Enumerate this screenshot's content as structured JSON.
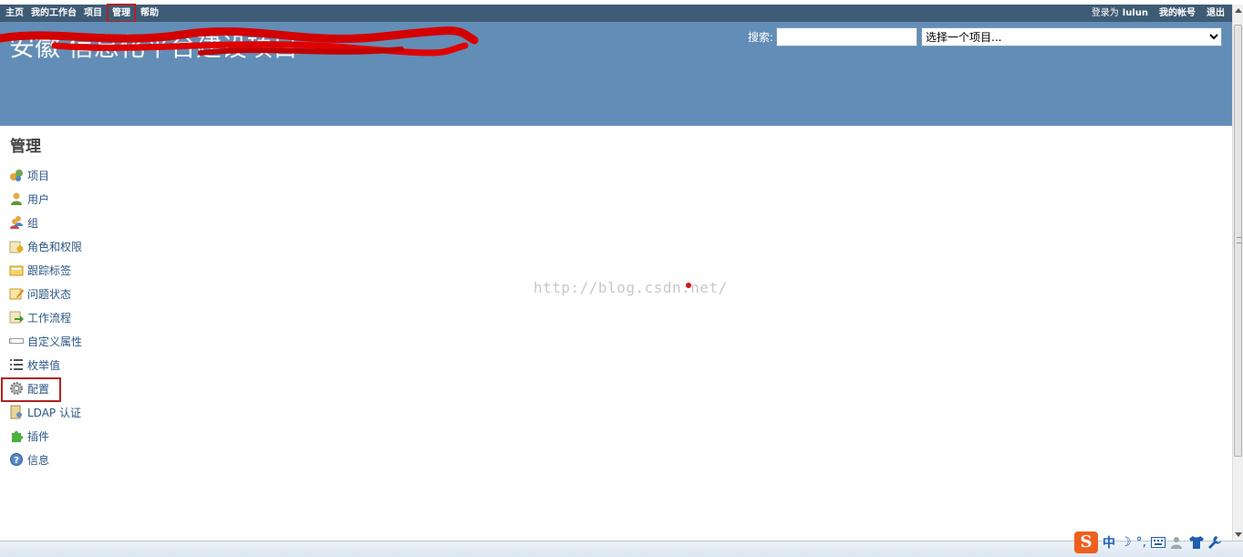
{
  "top_menu": {
    "left": [
      "主页",
      "我的工作台",
      "项目",
      "管理",
      "帮助"
    ],
    "logged_as_label": "登录为",
    "username": "lulun",
    "my_account": "我的帐号",
    "logout": "退出"
  },
  "header": {
    "title": "安徽 信息化平台建设项目",
    "search_label": "搜索:",
    "search_value": "",
    "project_select": "选择一个项目..."
  },
  "main": {
    "heading": "管理",
    "menu": [
      {
        "label": "项目",
        "icon": "projects-icon"
      },
      {
        "label": "用户",
        "icon": "user-icon"
      },
      {
        "label": "组",
        "icon": "group-icon"
      },
      {
        "label": "角色和权限",
        "icon": "roles-icon"
      },
      {
        "label": "跟踪标签",
        "icon": "trackers-icon"
      },
      {
        "label": "问题状态",
        "icon": "issue-status-icon"
      },
      {
        "label": "工作流程",
        "icon": "workflow-icon"
      },
      {
        "label": "自定义属性",
        "icon": "custom-fields-icon"
      },
      {
        "label": "枚举值",
        "icon": "list-icon"
      },
      {
        "label": "配置",
        "icon": "gear-icon"
      },
      {
        "label": "LDAP 认证",
        "icon": "ldap-icon"
      },
      {
        "label": "插件",
        "icon": "plugin-icon"
      },
      {
        "label": "信息",
        "icon": "info-icon"
      }
    ]
  },
  "watermark": "http://blog.csdn.net/",
  "ime": {
    "logo": "S",
    "mode": "中",
    "moon": "☽",
    "punct": "°,"
  },
  "colors": {
    "top_menu": "#3e5b76",
    "header": "#628db6",
    "link": "#2a5685",
    "highlight_box": "#b22222"
  }
}
